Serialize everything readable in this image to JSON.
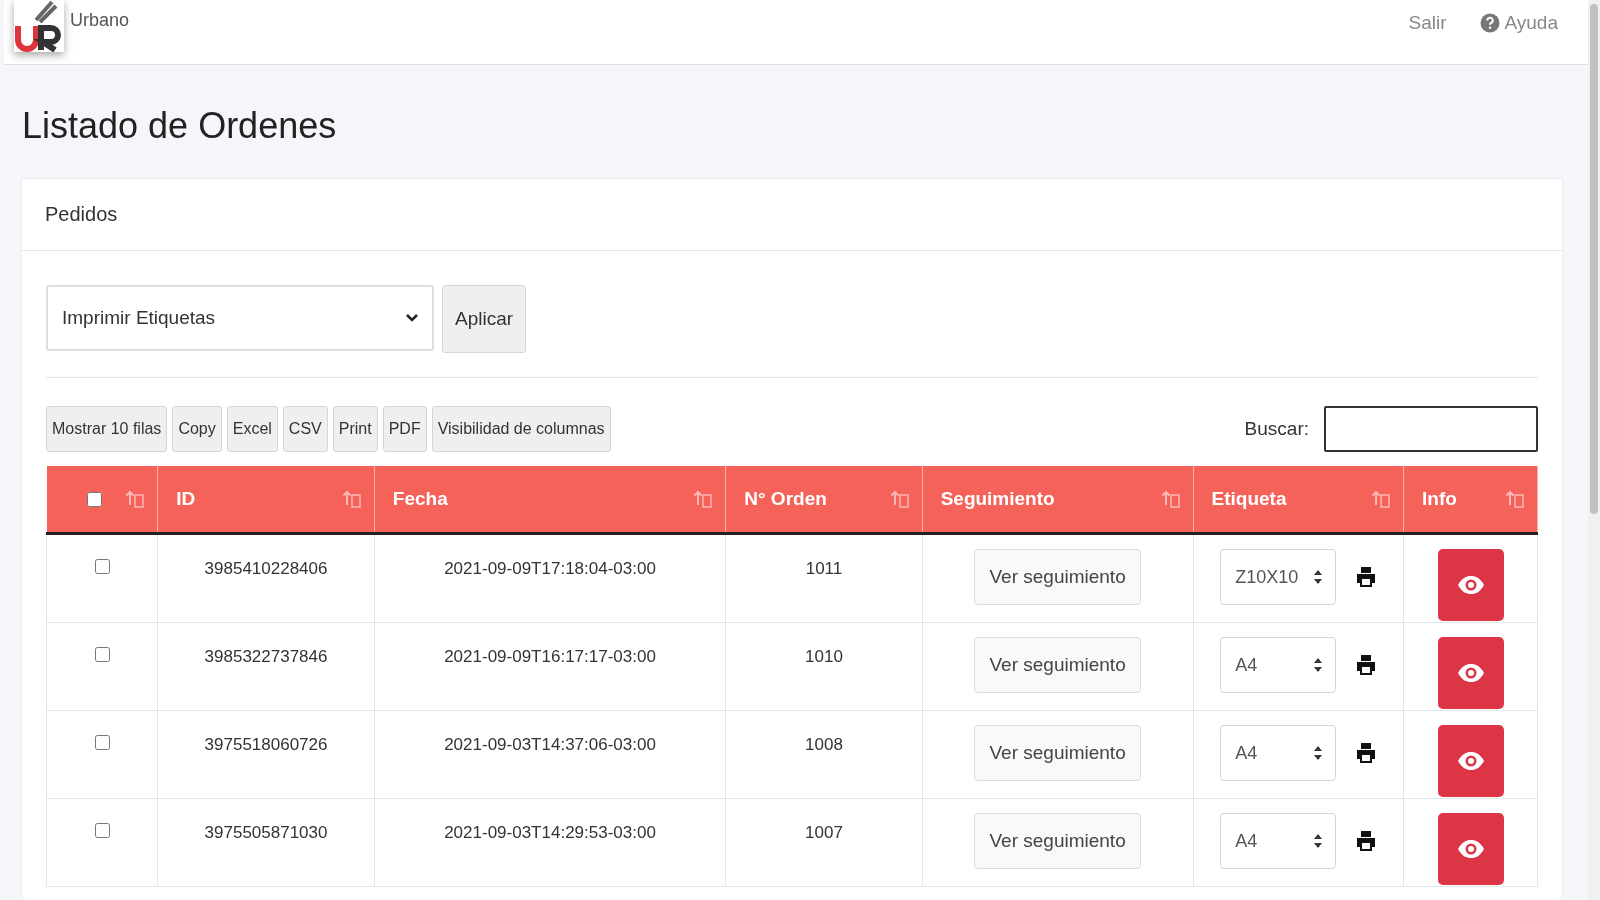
{
  "header": {
    "brand": "Urbano",
    "links": [
      {
        "label": "Salir",
        "kind": "plain"
      },
      {
        "label": "Ayuda",
        "kind": "help"
      }
    ]
  },
  "page_title": "Listado de Ordenes",
  "card": {
    "title": "Pedidos",
    "bulk_action": {
      "value": "Imprimir Etiquetas",
      "button": "Aplicar"
    },
    "toolbar": [
      "Mostrar 10 filas",
      "Copy",
      "Excel",
      "CSV",
      "Print",
      "PDF",
      "Visibilidad de columnas"
    ],
    "search": {
      "label": "Buscar:"
    },
    "table": {
      "select_all_checked": false,
      "columns": [
        "ID",
        "Fecha",
        "N° Orden",
        "Seguimiento",
        "Etiqueta",
        "Info"
      ],
      "rows": [
        {
          "checked": false,
          "id": "3985410228406",
          "fecha": "2021-09-09T17:18:04-03:00",
          "orden": "1011",
          "seguimiento": "Ver seguimiento",
          "etiqueta": "Z10X10"
        },
        {
          "checked": false,
          "id": "3985322737846",
          "fecha": "2021-09-09T16:17:17-03:00",
          "orden": "1010",
          "seguimiento": "Ver seguimiento",
          "etiqueta": "A4"
        },
        {
          "checked": false,
          "id": "3975518060726",
          "fecha": "2021-09-03T14:37:06-03:00",
          "orden": "1008",
          "seguimiento": "Ver seguimiento",
          "etiqueta": "A4"
        },
        {
          "checked": false,
          "id": "3975505871030",
          "fecha": "2021-09-03T14:29:53-03:00",
          "orden": "1007",
          "seguimiento": "Ver seguimiento",
          "etiqueta": "A4"
        }
      ]
    }
  }
}
